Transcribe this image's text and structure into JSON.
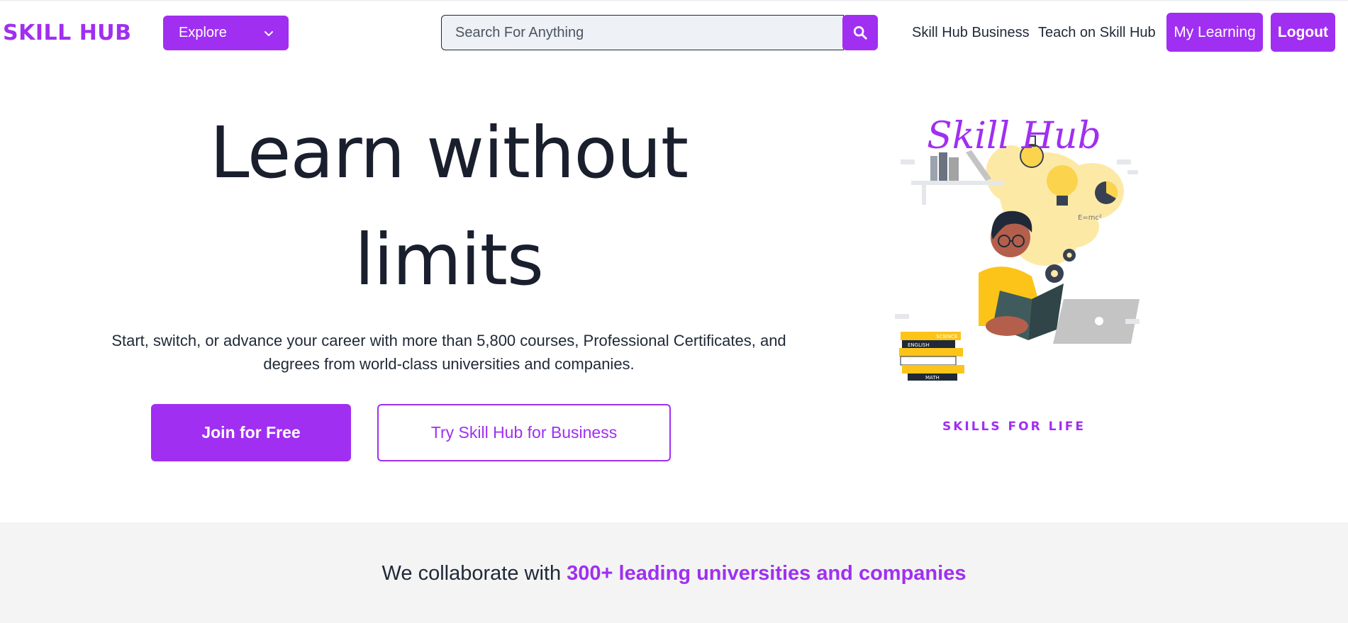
{
  "brand": {
    "name": "SKILL HUB",
    "accent": "#a02ff1"
  },
  "nav": {
    "explore_label": "Explore",
    "search_placeholder": "Search For Anything",
    "business_link": "Skill Hub Business",
    "teach_link": "Teach on Skill Hub",
    "my_learning": "My Learning",
    "logout": "Logout"
  },
  "hero": {
    "title": "Learn without limits",
    "subtitle": "Start, switch, or advance your career with more than 5,800 courses, Professional Certificates, and degrees from world-class universities and companies.",
    "join_button": "Join for Free",
    "business_button": "Try Skill Hub for Business"
  },
  "illustration": {
    "title": "Skill Hub",
    "tagline": "SKILLS FOR LIFE",
    "book_labels": [
      "SCIENCE",
      "ENGLISH",
      "MATH"
    ],
    "formula": "E=mc²"
  },
  "collab": {
    "prefix": "We collaborate with ",
    "highlight": "300+ leading universities and companies"
  }
}
